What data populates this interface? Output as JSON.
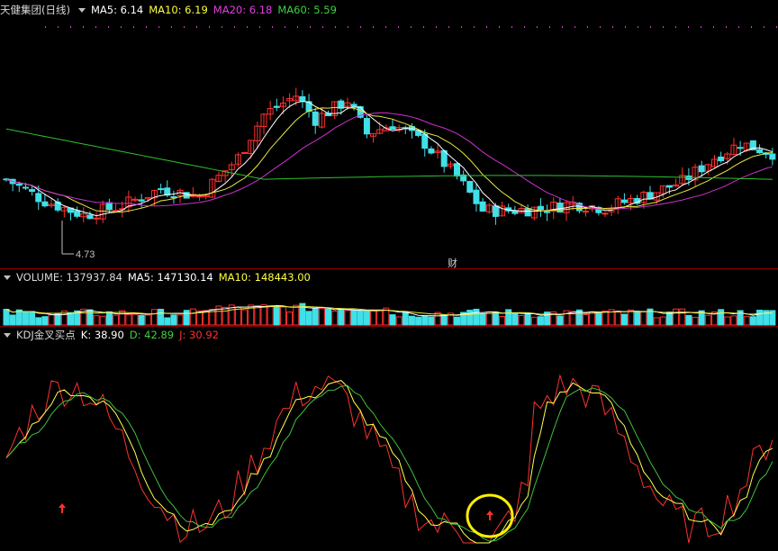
{
  "kline": {
    "title": "天健集团(日线)",
    "indicators": [
      {
        "label": "MA5: 6.14",
        "color": "#ffffff"
      },
      {
        "label": "MA10: 6.19",
        "color": "#ffff40"
      },
      {
        "label": "MA20: 6.18",
        "color": "#e040e0"
      },
      {
        "label": "MA60: 5.59",
        "color": "#40d040"
      }
    ],
    "low_label": "4.73",
    "finance_marker": "财",
    "colors": {
      "up": "#ff3030",
      "down": "#40e0e8",
      "ma5": "#ffffff",
      "ma10": "#e8e840",
      "ma20": "#d030d0",
      "ma60": "#30c030"
    }
  },
  "volume": {
    "title": "VOLUME: 137937.84",
    "indicators": [
      {
        "label": "MA5: 147130.14",
        "color": "#ffffff"
      },
      {
        "label": "MA10: 148443.00",
        "color": "#ffff40"
      }
    ]
  },
  "kdj": {
    "title": "KDJ金叉买点",
    "indicators": [
      {
        "label": "K: 38.90",
        "color": "#ffffff"
      },
      {
        "label": "D: 42.89",
        "color": "#40d040"
      },
      {
        "label": "J: 30.92",
        "color": "#ff3030"
      }
    ]
  },
  "chart_data": [
    {
      "type": "candlestick",
      "title": "天健集团(日线)",
      "series": [
        {
          "name": "MA5",
          "last": 6.14
        },
        {
          "name": "MA10",
          "last": 6.19
        },
        {
          "name": "MA20",
          "last": 6.18
        },
        {
          "name": "MA60",
          "last": 5.59
        }
      ],
      "annotations": [
        "4.73"
      ]
    },
    {
      "type": "bar",
      "title": "VOLUME",
      "series": [
        {
          "name": "VOLUME",
          "last": 137937.84
        },
        {
          "name": "MA5",
          "last": 147130.14
        },
        {
          "name": "MA10",
          "last": 148443.0
        }
      ]
    },
    {
      "type": "line",
      "title": "KDJ金叉买点",
      "series": [
        {
          "name": "K",
          "last": 38.9
        },
        {
          "name": "D",
          "last": 42.89
        },
        {
          "name": "J",
          "last": 30.92
        }
      ]
    }
  ]
}
